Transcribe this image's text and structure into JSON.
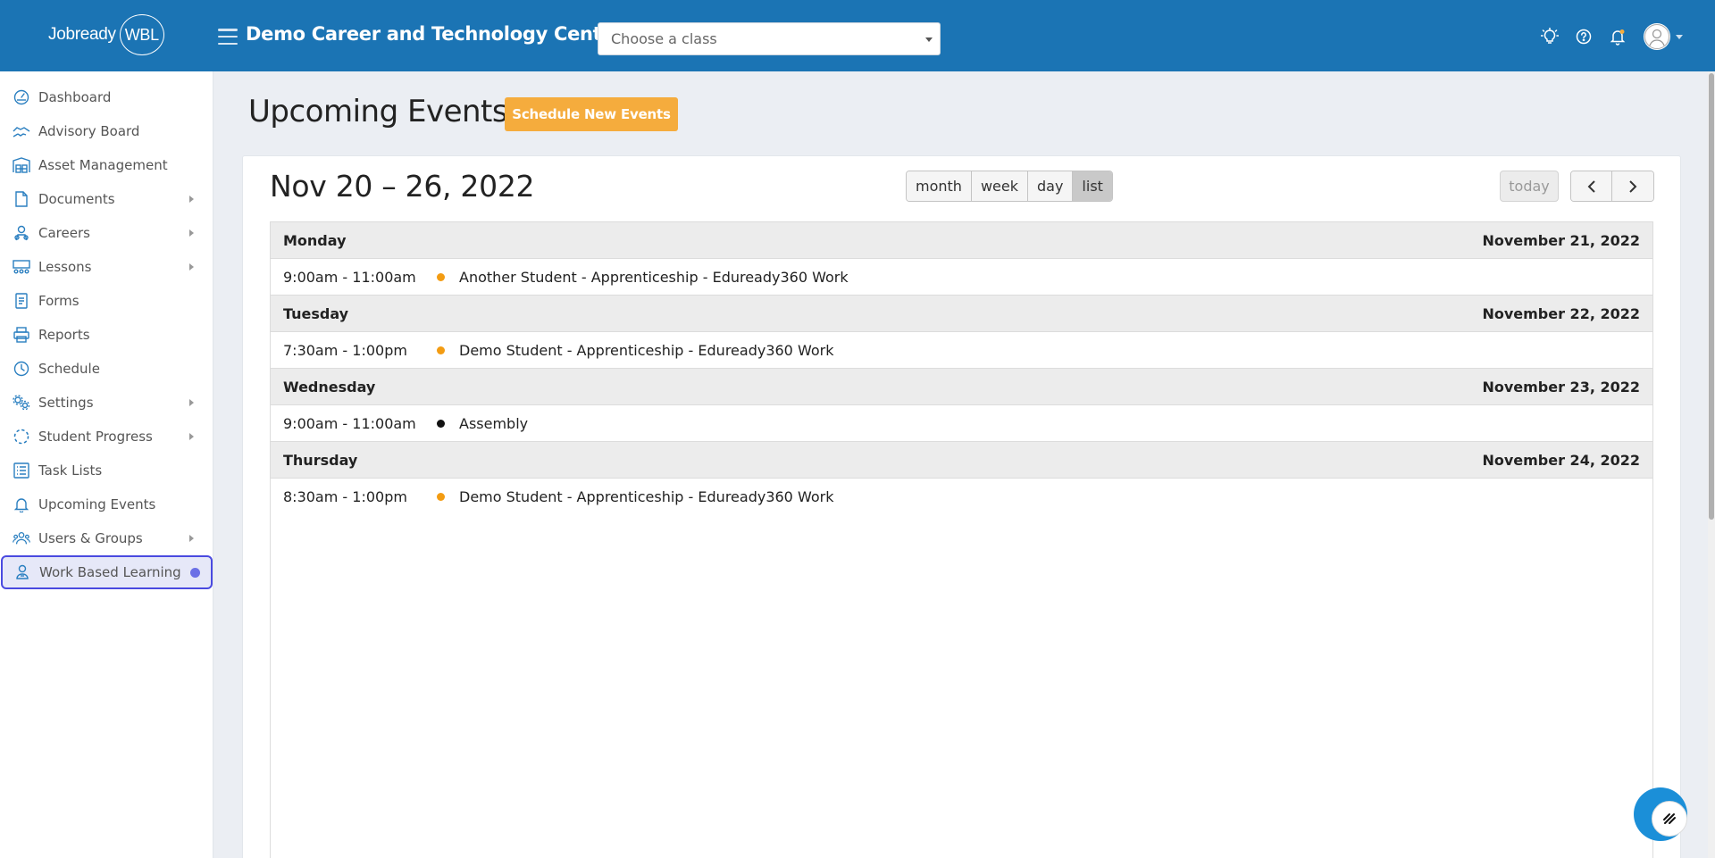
{
  "app": {
    "logo_text": "Jobready",
    "logo_badge": "WBL",
    "org_title": "Demo Career and Technology Center",
    "class_select": {
      "placeholder": "Choose a class"
    }
  },
  "sidebar": {
    "items": [
      {
        "label": "Dashboard",
        "icon": "dashboard-icon",
        "has_submenu": false
      },
      {
        "label": "Advisory Board",
        "icon": "handshake-icon",
        "has_submenu": false
      },
      {
        "label": "Asset Management",
        "icon": "warehouse-icon",
        "has_submenu": false
      },
      {
        "label": "Documents",
        "icon": "document-icon",
        "has_submenu": true
      },
      {
        "label": "Careers",
        "icon": "careers-icon",
        "has_submenu": true
      },
      {
        "label": "Lessons",
        "icon": "lessons-icon",
        "has_submenu": true
      },
      {
        "label": "Forms",
        "icon": "form-icon",
        "has_submenu": false
      },
      {
        "label": "Reports",
        "icon": "printer-icon",
        "has_submenu": false
      },
      {
        "label": "Schedule",
        "icon": "clock-icon",
        "has_submenu": false
      },
      {
        "label": "Settings",
        "icon": "gears-icon",
        "has_submenu": true
      },
      {
        "label": "Student Progress",
        "icon": "progress-spinner-icon",
        "has_submenu": true
      },
      {
        "label": "Task Lists",
        "icon": "list-icon",
        "has_submenu": false
      },
      {
        "label": "Upcoming Events",
        "icon": "bell-icon",
        "has_submenu": false
      },
      {
        "label": "Users & Groups",
        "icon": "users-icon",
        "has_submenu": true
      },
      {
        "label": "Work Based Learning",
        "icon": "user-badge-icon",
        "has_submenu": false,
        "active": true
      }
    ]
  },
  "main": {
    "title": "Upcoming Events",
    "schedule_button": "Schedule New Events",
    "range_title": "Nov 20 – 26, 2022",
    "views": [
      "month",
      "week",
      "day",
      "list"
    ],
    "active_view": "list",
    "today_button": "today",
    "days": [
      {
        "day": "Monday",
        "date": "November 21, 2022",
        "events": [
          {
            "time": "9:00am - 11:00am",
            "title": "Another Student - Apprenticeship - Eduready360 Work",
            "color": "#f39c12"
          }
        ]
      },
      {
        "day": "Tuesday",
        "date": "November 22, 2022",
        "events": [
          {
            "time": "7:30am - 1:00pm",
            "title": "Demo Student - Apprenticeship - Eduready360 Work",
            "color": "#f39c12"
          }
        ]
      },
      {
        "day": "Wednesday",
        "date": "November 23, 2022",
        "events": [
          {
            "time": "9:00am - 11:00am",
            "title": "Assembly",
            "color": "#111111"
          }
        ]
      },
      {
        "day": "Thursday",
        "date": "November 24, 2022",
        "events": [
          {
            "time": "8:30am - 1:00pm",
            "title": "Demo Student - Apprenticeship - Eduready360 Work",
            "color": "#f39c12"
          }
        ]
      }
    ]
  },
  "colors": {
    "header_bg": "#1b74b4",
    "accent_orange": "#f5ac3d",
    "active_nav_border": "#4a4ae0"
  }
}
